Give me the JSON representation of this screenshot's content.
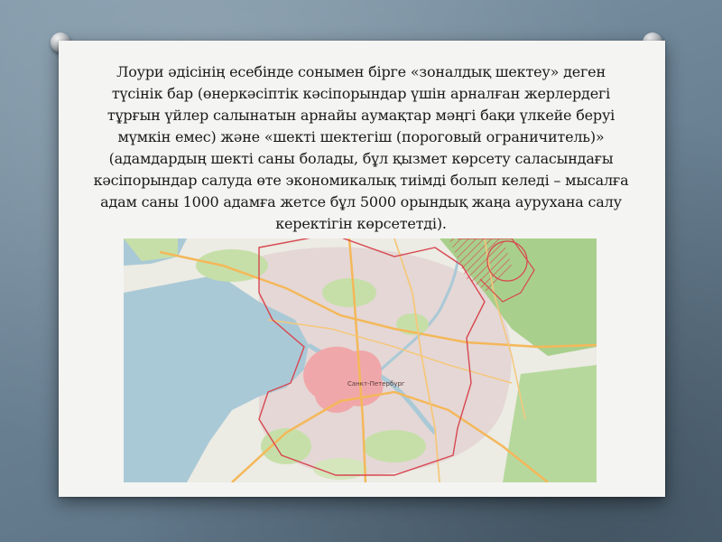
{
  "slide": {
    "paragraph": "Лоури әдісінің есебінде сонымен бірге «зоналдық шектеу» деген түсінік бар  (өнеркәсіптік кәсіпорындар үшін арналған жерлердегі тұрғын үйлер салынатын арнайы аумақтар мәңгі бақи үлкейе беруі мүмкін емес) және «шекті шектегіш (пороговый ограничитель)» (адамдардың шекті саны болады, бұл қызмет көрсету саласындағы кәсіпорындар салуда өте экономикалық тиімді болып келеді – мысалға адам саны 1000 адамға жетсе бұл 5000 орындық жаңа аурухана салу керектігін көрсететді)."
  },
  "map": {
    "city_label": "Санкт-Петербург",
    "colors": {
      "water": "#aac9d6",
      "land": "#ecebe4",
      "park": "#c6dfa8",
      "forest": "#a9cf8c",
      "urban": "#e3d3d3",
      "center": "#f0a7a9",
      "road": "#f4b85a",
      "zone_border": "#d8474f"
    }
  }
}
